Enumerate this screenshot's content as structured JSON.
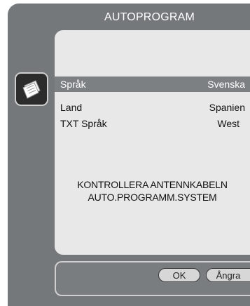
{
  "dialog": {
    "title": "AUTOPROGRAM"
  },
  "icons": {
    "side": "notes-icon"
  },
  "settings": [
    {
      "label": "Språk",
      "value": "Svenska",
      "selected": true
    },
    {
      "label": "Land",
      "value": "Spanien",
      "selected": false
    },
    {
      "label": "TXT Språk",
      "value": "West",
      "selected": false
    }
  ],
  "message": {
    "line1": "KONTROLLERA ANTENNKABELN",
    "line2": "AUTO.PROGRAMM.SYSTEM"
  },
  "buttons": {
    "ok": "OK",
    "cancel": "Ångra"
  },
  "colors": {
    "frame": "#75787a",
    "panel": "#e8e8e8",
    "selected_row": "#7d8083"
  }
}
